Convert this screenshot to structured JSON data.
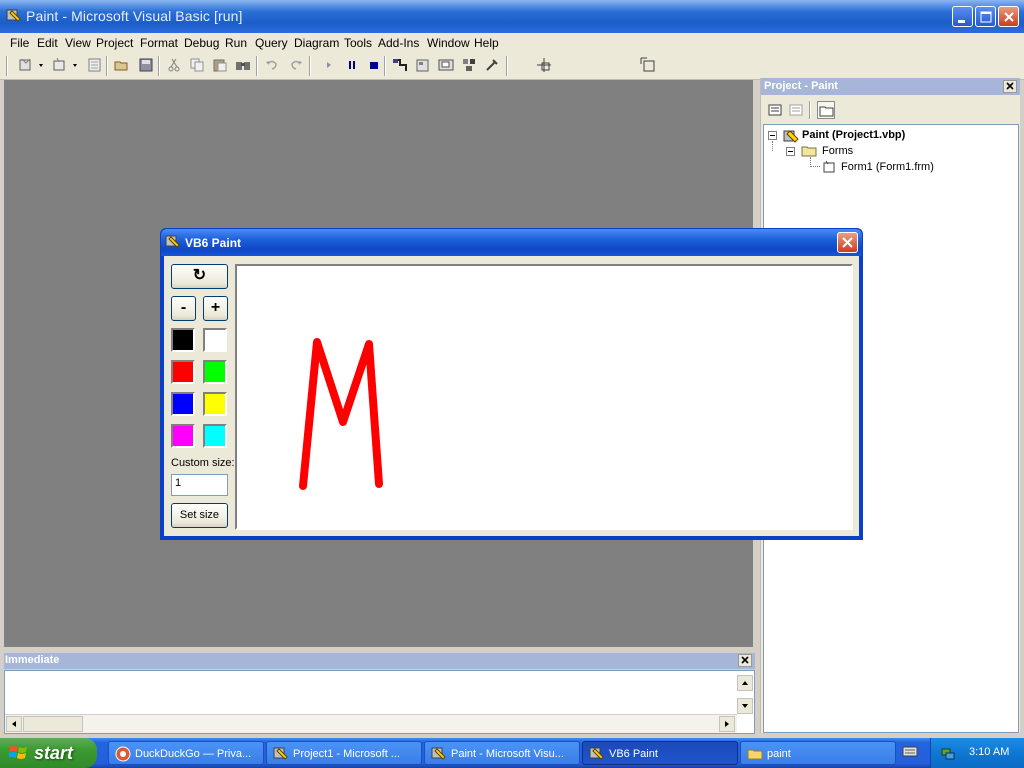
{
  "window": {
    "title": "Paint - Microsoft Visual Basic [run]"
  },
  "menu": [
    "File",
    "Edit",
    "View",
    "Project",
    "Format",
    "Debug",
    "Run",
    "Query",
    "Diagram",
    "Tools",
    "Add-Ins",
    "Window",
    "Help"
  ],
  "toolbar": {
    "icons": [
      "add-project-icon",
      "add-form-icon",
      "menu-editor-icon",
      "open-icon",
      "save-icon",
      "cut-icon",
      "copy-icon",
      "paste-icon",
      "find-icon",
      "undo-icon",
      "redo-icon",
      "start-icon",
      "break-icon",
      "end-icon",
      "project-explorer-icon",
      "properties-icon",
      "form-layout-icon",
      "object-browser-icon",
      "toolbox-icon",
      "position-icon",
      "size-icon"
    ]
  },
  "project_explorer": {
    "title": "Project - Paint",
    "tree": {
      "project": "Paint (Project1.vbp)",
      "folder": "Forms",
      "form": "Form1 (Form1.frm)"
    }
  },
  "immediate": {
    "title": "Immediate"
  },
  "paint_form": {
    "title": "VB6 Paint",
    "clear_symbol": "↻",
    "minus_label": "-",
    "plus_label": "+",
    "swatches": [
      "#000000",
      "#ffffff",
      "#ff0000",
      "#00ff00",
      "#0000ff",
      "#ffff00",
      "#ff00ff",
      "#00ffff"
    ],
    "custom_size_label": "Custom size:",
    "custom_size_value": "1",
    "set_size_label": "Set size",
    "stroke_color": "#ff0000"
  },
  "taskbar": {
    "start_label": "start",
    "tasks": [
      {
        "label": "DuckDuckGo — Priva...",
        "icon": "browser-icon"
      },
      {
        "label": "Project1 - Microsoft ...",
        "icon": "vb-icon"
      },
      {
        "label": "Paint - Microsoft Visu...",
        "icon": "vb-icon"
      },
      {
        "label": "VB6 Paint",
        "icon": "form-icon"
      },
      {
        "label": "paint",
        "icon": "folder-icon"
      }
    ],
    "clock": "3:10 AM"
  },
  "colors": {
    "xp_blue": "#245edb",
    "mdi_gray": "#808080",
    "panel_title": "#a6b5d8",
    "start_green": "#3c9a32"
  }
}
